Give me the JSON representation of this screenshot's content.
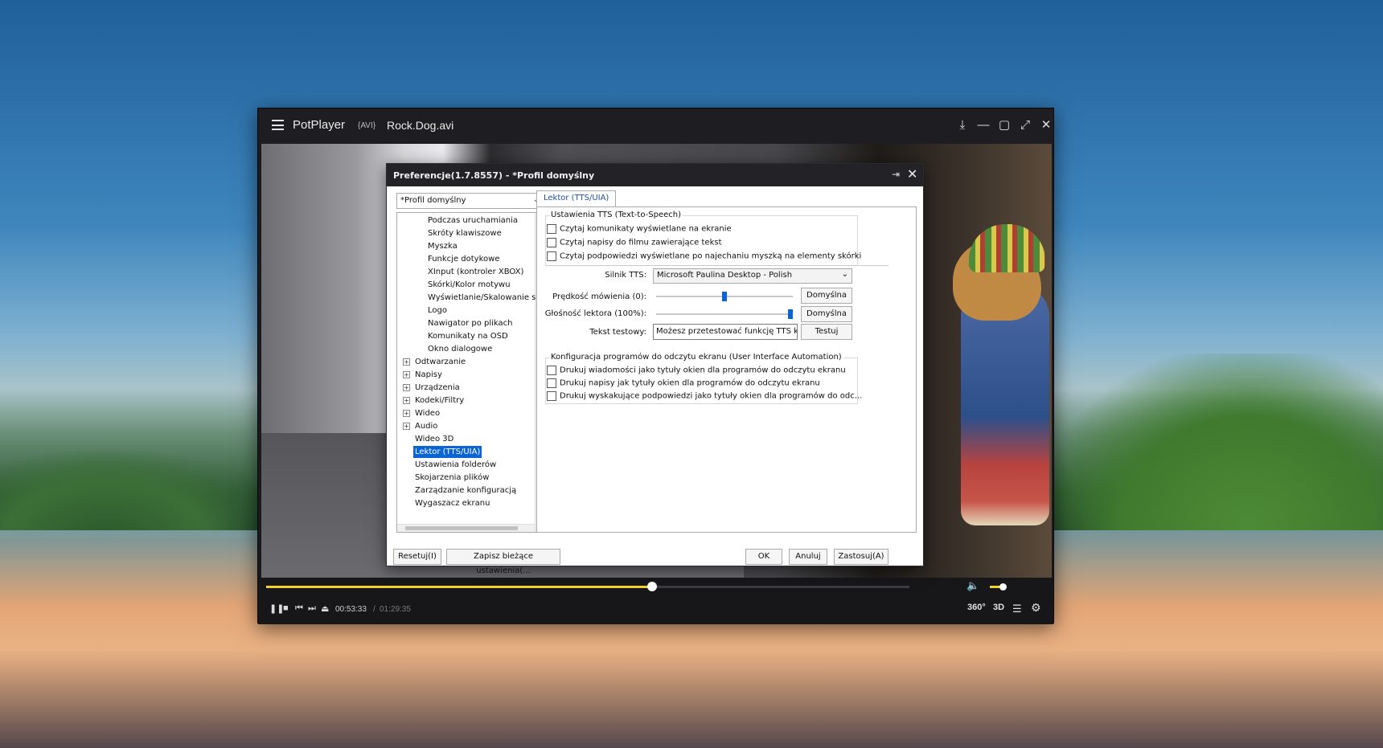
{
  "player": {
    "app_name": "PotPlayer",
    "file_format": "{AVI}",
    "file_name": "Rock.Dog.avi",
    "time_current": "00:53:33",
    "time_separator": "/",
    "time_total": "01:29:35",
    "seek_progress": 0.6,
    "volume_level": 0.8,
    "icons": {
      "menu": "hamburger-icon",
      "pin": "pin-icon",
      "minimize": "minimize-icon",
      "maximize": "maximize-icon",
      "fullscreen": "fullscreen-icon",
      "close": "close-icon",
      "pause": "pause-icon",
      "stop": "stop-icon",
      "prev": "previous-icon",
      "next": "next-icon",
      "eject": "eject-icon",
      "volume": "volume-icon",
      "playlist": "playlist-icon",
      "settings": "gear-icon"
    },
    "btn_360": "360°",
    "btn_3d": "3D",
    "accent_color": "#f2d12b"
  },
  "dialog": {
    "title": "Preferencje(1.7.8557) - *Profil domyślny",
    "profile_selected": "*Profil domyślny",
    "tree": {
      "children": [
        "Podczas uruchamiania",
        "Skróty klawiszowe",
        "Myszka",
        "Funkcje dotykowe",
        "XInput (kontroler XBOX)",
        "Skórki/Kolor motywu",
        "Wyświetlanie/Skalowanie sk",
        "Logo",
        "Nawigator po plikach",
        "Komunikaty na OSD",
        "Okno dialogowe"
      ],
      "expandable": [
        "Odtwarzanie",
        "Napisy",
        "Urządzenia",
        "Kodeki/Filtry",
        "Wideo",
        "Audio"
      ],
      "plain": [
        "Wideo 3D",
        "Lektor (TTS/UIA)",
        "Ustawienia folderów",
        "Skojarzenia plików",
        "Zarządzanie konfiguracją",
        "Wygaszacz ekranu"
      ],
      "selected": "Lektor (TTS/UIA)"
    },
    "tab_label": "Lektor (TTS/UIA)",
    "tts_group": {
      "title": "Ustawienia TTS (Text-to-Speech)",
      "checkboxes": [
        "Czytaj komunikaty wyświetlane na ekranie",
        "Czytaj napisy do filmu zawierające tekst",
        "Czytaj podpowiedzi wyświetlane po najechaniu myszką na elementy skórki"
      ],
      "engine_label": "Silnik TTS:",
      "engine_value": "Microsoft Paulina Desktop - Polish",
      "speed_label": "Prędkość mówienia (0):",
      "speed_level": 0.5,
      "volume_label": "Głośność lektora (100%):",
      "volume_level": 1.0,
      "default_button": "Domyślna",
      "test_label": "Tekst testowy:",
      "test_value": "Możesz przetestować funkcję TTS klikając",
      "test_button": "Testuj"
    },
    "uia_group": {
      "title": "Konfiguracja programów do odczytu ekranu (User Interface Automation)",
      "checkboxes": [
        "Drukuj wiadomości jako tytuły okien dla programów do odczytu ekranu",
        "Drukuj napisy jak tytuły okien dla programów do odczytu ekranu",
        "Drukuj wyskakujące podpowiedzi jako tytuły okien dla programów do odc..."
      ]
    },
    "footer": {
      "reset": "Resetuj(I)",
      "save": "Zapisz bieżące ustawienia(...",
      "ok": "OK",
      "cancel": "Anuluj",
      "apply": "Zastosuj(A)"
    }
  }
}
